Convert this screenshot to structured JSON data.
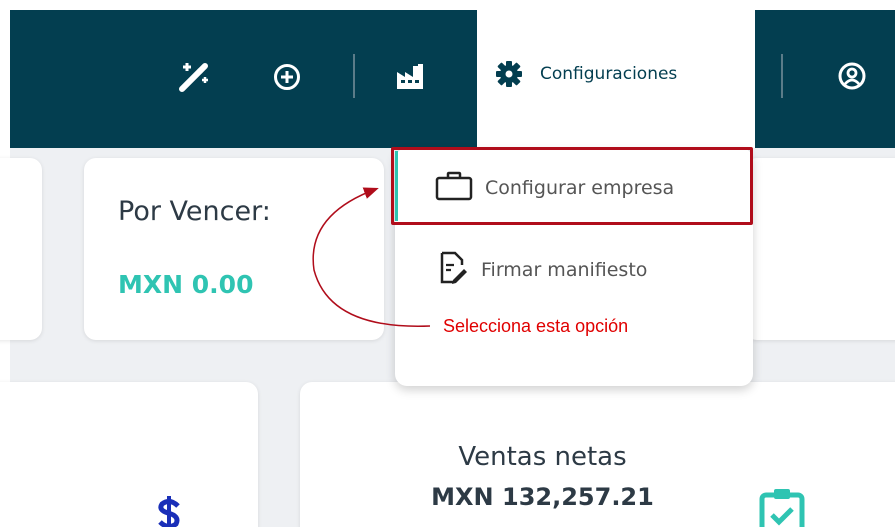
{
  "navbar": {
    "config_label": "Configuraciones"
  },
  "cards": {
    "por_vencer": {
      "title": "Por Vencer:",
      "value": "MXN 0.00"
    },
    "ventas": {
      "title": "Ventas netas",
      "value": "MXN 132,257.21"
    }
  },
  "dropdown": {
    "items": [
      {
        "label": "Configurar empresa",
        "icon": "briefcase-icon"
      },
      {
        "label": "Firmar manifiesto",
        "icon": "sign-document-icon"
      }
    ]
  },
  "annotation": {
    "text": "Selecciona esta opción"
  },
  "colors": {
    "navbar": "#033e50",
    "accent_teal": "#2fc4b2",
    "highlight_red": "#b00d1b",
    "annotation_red": "#e00000",
    "dollar_blue": "#1a2fb8"
  }
}
